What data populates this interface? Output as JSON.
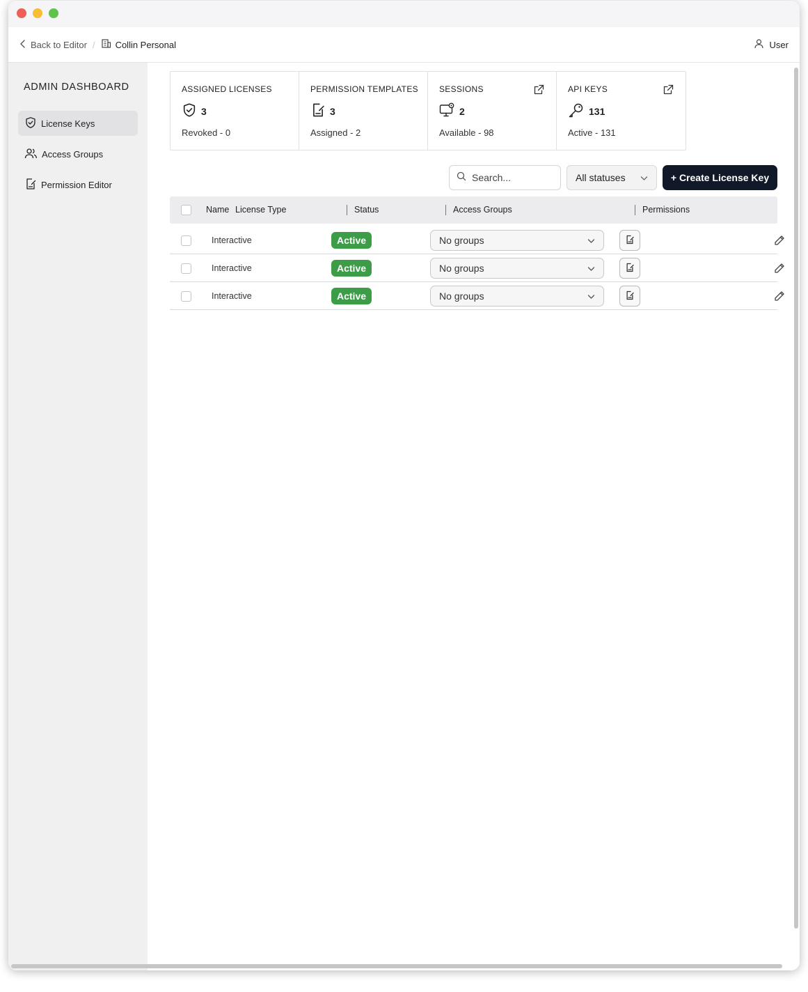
{
  "topbar": {
    "back_label": "Back to Editor",
    "separator": "/",
    "org_name": "Collin Personal",
    "user_label": "User"
  },
  "sidebar": {
    "title": "ADMIN DASHBOARD",
    "items": [
      {
        "label": "License Keys",
        "icon": "shield-check-icon",
        "active": true
      },
      {
        "label": "Access Groups",
        "icon": "users-icon",
        "active": false
      },
      {
        "label": "Permission Editor",
        "icon": "document-edit-icon",
        "active": false
      }
    ]
  },
  "cards": [
    {
      "title": "ASSIGNED LICENSES",
      "value": "3",
      "sub": "Revoked - 0",
      "icon": "shield-check-icon"
    },
    {
      "title": "PERMISSION TEMPLATES",
      "value": "3",
      "sub": "Assigned - 2",
      "icon": "document-edit-icon"
    },
    {
      "title": "SESSIONS",
      "value": "2",
      "sub": "Available - 98",
      "icon": "monitor-gear-icon"
    },
    {
      "title": "API KEYS",
      "value": "131",
      "sub": "Active - 131",
      "icon": "key-icon"
    }
  ],
  "toolbar": {
    "search_placeholder": "Search...",
    "status_filter": "All statuses",
    "create_label": "+ Create License Key"
  },
  "table": {
    "headers": {
      "name": "Name",
      "license_type": "License Type",
      "status": "Status",
      "access_groups": "Access Groups",
      "permissions": "Permissions"
    },
    "rows": [
      {
        "license_type": "Interactive",
        "status": "Active",
        "groups": "No groups"
      },
      {
        "license_type": "Interactive",
        "status": "Active",
        "groups": "No groups"
      },
      {
        "license_type": "Interactive",
        "status": "Active",
        "groups": "No groups"
      }
    ]
  },
  "colors": {
    "accent_dark": "#111827",
    "active_badge": "#3d9c48",
    "sidebar_bg": "#f0f0f0"
  }
}
